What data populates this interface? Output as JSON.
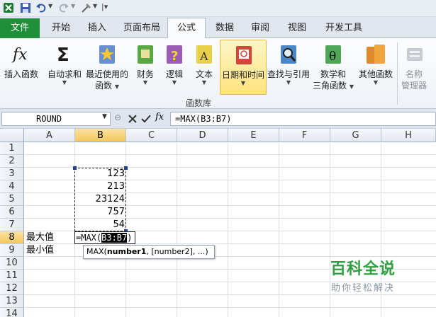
{
  "tabs": {
    "file": "文件",
    "items": [
      "开始",
      "插入",
      "页面布局",
      "公式",
      "数据",
      "审阅",
      "视图",
      "开发工具"
    ],
    "active": "公式"
  },
  "ribbon": {
    "insert_function": "插入函数",
    "autosum": "自动求和",
    "recent_line1": "最近使用的",
    "recent_line2": "函数",
    "financial": "财务",
    "logical": "逻辑",
    "text": "文本",
    "datetime": "日期和时间",
    "lookup": "查找与引用",
    "math_line1": "数学和",
    "math_line2": "三角函数",
    "more": "其他函数",
    "name_mgr_line1": "名称",
    "name_mgr_line2": "管理器",
    "group_label": "函数库",
    "accent": "#fde27e"
  },
  "formula_bar": {
    "name_box": "ROUND",
    "fx": "fx",
    "formula": "=MAX(B3:B7)"
  },
  "columns": [
    "A",
    "B",
    "C",
    "D",
    "E",
    "F",
    "G",
    "H"
  ],
  "rows": [
    "1",
    "2",
    "3",
    "4",
    "5",
    "6",
    "7",
    "8",
    "9",
    "10",
    "11",
    "12",
    "13",
    "14"
  ],
  "cells": {
    "b3": "123",
    "b4": "213",
    "b5": "23124",
    "b6": "757",
    "b7": "54",
    "a8": "最大值",
    "a9": "最小值"
  },
  "editing": {
    "prefix": "=MAX(",
    "ref": "B3:B7",
    "suffix": ")"
  },
  "tooltip": {
    "fn": "MAX(",
    "arg1": "number1",
    "rest": ", [number2], ...)"
  },
  "watermark": {
    "title": "百科全说",
    "subtitle": "助你轻松解决"
  }
}
